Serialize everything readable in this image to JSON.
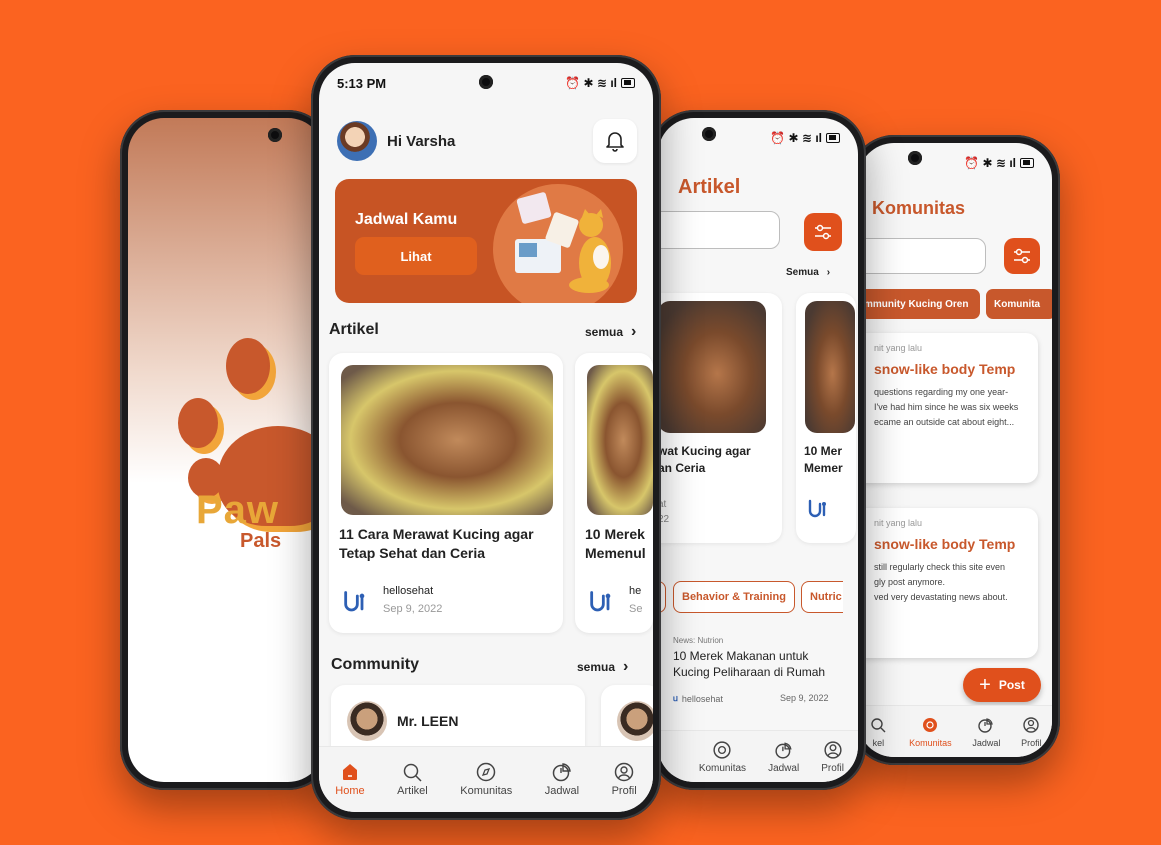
{
  "home": {
    "status_time": "5:13 PM",
    "greeting": "Hi Varsha",
    "banner_title": "Jadwal Kamu",
    "banner_button": "Lihat",
    "artikel_heading": "Artikel",
    "artikel_link": "semua",
    "articles": [
      {
        "title_line1": "11 Cara Merawat Kucing agar",
        "title_line2": "Tetap Sehat dan Ceria",
        "source": "hellosehat",
        "date": "Sep 9, 2022"
      },
      {
        "title_line1": "10 Merek",
        "title_line2": "Memenul",
        "source": "he",
        "date": "Se"
      }
    ],
    "community_heading": "Community",
    "community_link": "semua",
    "community_user": "Mr. LEEN"
  },
  "nav_home": [
    {
      "label": "Home",
      "icon": "home-icon",
      "active": true
    },
    {
      "label": "Artikel",
      "icon": "search-icon",
      "active": false
    },
    {
      "label": "Komunitas",
      "icon": "compass-icon",
      "active": false
    },
    {
      "label": "Jadwal",
      "icon": "clock-icon",
      "active": false
    },
    {
      "label": "Profil",
      "icon": "profile-icon",
      "active": false
    }
  ],
  "artikel_screen": {
    "title": "Artikel",
    "section_label": "s",
    "link": "Semua",
    "cards": [
      {
        "title_line1": "wat Kucing agar",
        "title_line2": "an Ceria",
        "meta1": "at",
        "meta2": "22"
      },
      {
        "title_line1": "10 Mer",
        "title_line2": "Memer"
      }
    ],
    "tags": [
      "Behavior & Training",
      "Nutric"
    ],
    "news_category": "News: Nutrion",
    "news_title": "10 Merek Makanan untuk Kucing Peliharaan di Rumah",
    "news_source": "hellosehat",
    "news_date": "Sep 9, 2022",
    "nav": [
      "Komunitas",
      "Jadwal",
      "Profil"
    ]
  },
  "komunitas_screen": {
    "title": "Komunitas",
    "chips": [
      "mmunity Kucing Oren",
      "Komunita"
    ],
    "posts": [
      {
        "time": "nit yang lalu",
        "title": "snow-like body Temp",
        "body_line1": "questions regarding my one year-",
        "body_line2": "I've had him  since he was six weeks",
        "body_line3": "ecame an outside cat about eight..."
      },
      {
        "time": "nit yang lalu",
        "title": "snow-like body Temp",
        "body_line1": "still regularly check this site even",
        "body_line2": "gly post anymore.",
        "body_line3": "ved very devastating news about."
      }
    ],
    "post_button": "Post",
    "nav": [
      "kel",
      "Komunitas",
      "Jadwal",
      "Profil"
    ]
  },
  "brand": {
    "logo_word": "Paw",
    "logo_sub": "Pals",
    "accent": "#e0501c",
    "brand_orange": "#c8582c",
    "background": "#fb6320"
  }
}
